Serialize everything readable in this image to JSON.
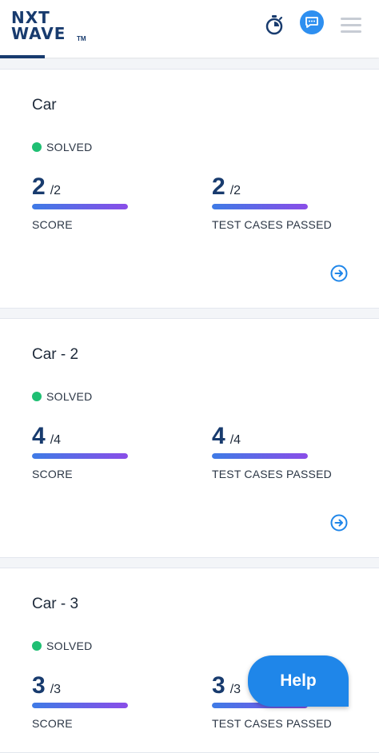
{
  "header": {
    "logo_line1": "NXT",
    "logo_line2": "WAVE",
    "logo_tm": "TM",
    "icons": [
      "timer-icon",
      "chat-icon",
      "hamburger-menu-icon"
    ]
  },
  "problems": [
    {
      "title": "Car",
      "status": "SOLVED",
      "score": {
        "value": "2",
        "total": "/2",
        "label": "SCORE",
        "fraction": 1.0
      },
      "test_cases": {
        "value": "2",
        "total": "/2",
        "label": "TEST CASES PASSED",
        "fraction": 1.0
      }
    },
    {
      "title": "Car - 2",
      "status": "SOLVED",
      "score": {
        "value": "4",
        "total": "/4",
        "label": "SCORE",
        "fraction": 1.0
      },
      "test_cases": {
        "value": "4",
        "total": "/4",
        "label": "TEST CASES PASSED",
        "fraction": 1.0
      }
    },
    {
      "title": "Car - 3",
      "status": "SOLVED",
      "score": {
        "value": "3",
        "total": "/3",
        "label": "SCORE",
        "fraction": 1.0
      },
      "test_cases": {
        "value": "3",
        "total": "/3",
        "label": "TEST CASES PASSED",
        "fraction": 1.0
      }
    }
  ],
  "help_button": {
    "label": "Help"
  },
  "colors": {
    "brand_navy": "#183b6e",
    "solved_green": "#1fbf73",
    "progress_start": "#3e7be6",
    "progress_end": "#8a4de8",
    "help_blue": "#1f86e9"
  }
}
